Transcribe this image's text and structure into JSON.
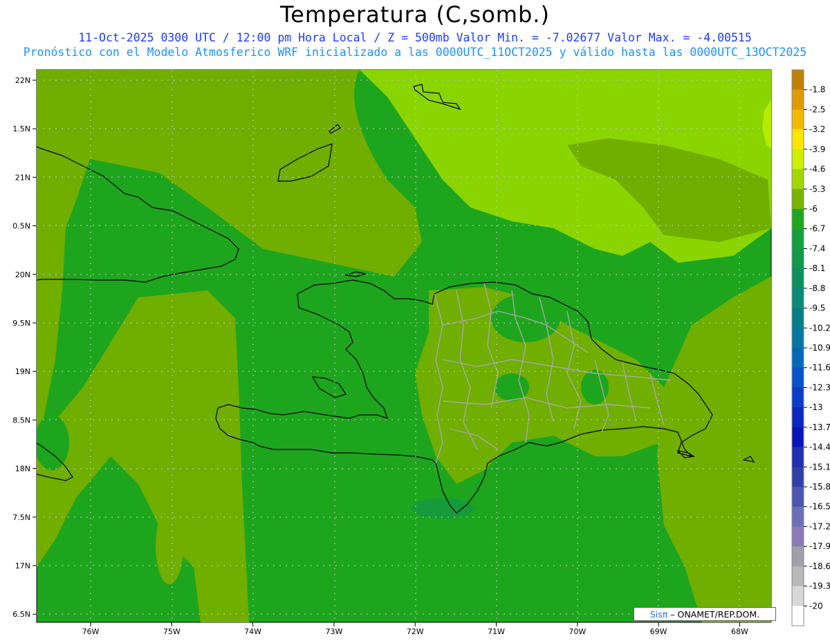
{
  "title": "Temperatura (C,somb.)",
  "subtitle_line1": "11-Oct-2025  0300 UTC / 12:00 pm Hora Local / Z = 500mb  Valor Min. = -7.02677  Valor Max. = -4.00515",
  "subtitle_line2": "Pronóstico con el Modelo Atmosferico WRF inicializado a las 0000UTC_11OCT2025 y válido hasta las  0000UTC_13OCT2025",
  "lat_labels": [
    "22N",
    "1.5N",
    "21N",
    "0.5N",
    "20N",
    "9.5N",
    "19N",
    "8.5N",
    "18N",
    "7.5N",
    "17N",
    "6.5N"
  ],
  "lon_labels": [
    "76W",
    "75W",
    "74W",
    "73W",
    "72W",
    "71W",
    "70W",
    "69W",
    "68W"
  ],
  "colorbar": {
    "labels": [
      "-1.8",
      "-2.5",
      "-3.2",
      "-3.9",
      "-4.6",
      "-5.3",
      "-6",
      "-6.7",
      "-7.4",
      "-8.1",
      "-8.8",
      "-9.5",
      "-10.2",
      "-10.9",
      "-11.6",
      "-12.3",
      "-13",
      "-13.7",
      "-14.4",
      "-15.1",
      "-15.8",
      "-16.5",
      "-17.2",
      "-17.9",
      "-18.6",
      "-19.3",
      "-20"
    ],
    "colors": [
      "#c08000",
      "#e29a00",
      "#f3bb00",
      "#ffe600",
      "#ccf000",
      "#a3d600",
      "#78b400",
      "#22a620",
      "#15a040",
      "#109a4a",
      "#0d9060",
      "#0a8a78",
      "#067e88",
      "#0478a0",
      "#0468b8",
      "#0652c8",
      "#0a3cc8",
      "#0a28c0",
      "#0a14b8",
      "#2030b0",
      "#3040a8",
      "#4a56b0",
      "#6a70b8",
      "#8a7ab8",
      "#a0a0a8",
      "#b8b8b8",
      "#d8d8d8",
      "#ffffff"
    ]
  },
  "field_colors": {
    "light": "#8ad400",
    "yellowgreen": "#b4ec00",
    "olive": "#70ae00",
    "green": "#1ea51e"
  },
  "logo": {
    "sis": "Sisπ",
    "rest": " – ONAMET/REP.DOM."
  }
}
